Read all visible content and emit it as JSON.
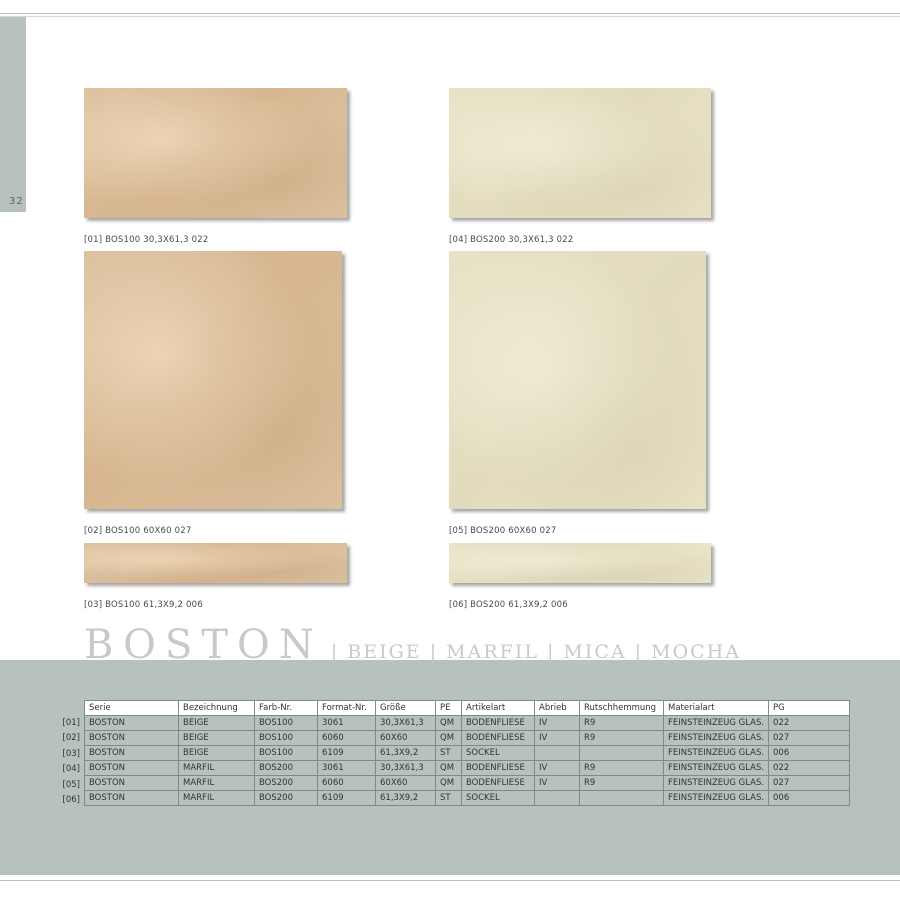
{
  "page_number": "32",
  "tiles": [
    {
      "label": "[01]  BOS100  30,3X61,3  022"
    },
    {
      "label": "[02]  BOS100  60X60  027"
    },
    {
      "label": "[03]  BOS100  61,3X9,2  006"
    },
    {
      "label": "[04]  BOS200  30,3X61,3  022"
    },
    {
      "label": "[05]  BOS200  60X60  027"
    },
    {
      "label": "[06]  BOS200  61,3X9,2  006"
    }
  ],
  "title": {
    "main": "BOSTON",
    "sub": " | BEIGE | MARFIL | MICA | MOCHA"
  },
  "table": {
    "headers": [
      "Serie",
      "Bezeichnung",
      "Farb-Nr.",
      "Format-Nr.",
      "Größe",
      "PE",
      "Artikelart",
      "Abrieb",
      "Rutschhemmung",
      "Materialart",
      "PG"
    ],
    "row_labels": [
      "[01]",
      "[02]",
      "[03]",
      "[04]",
      "[05]",
      "[06]"
    ],
    "rows": [
      [
        "BOSTON",
        "BEIGE",
        "BOS100",
        "3061",
        "30,3X61,3",
        "QM",
        "BODENFLIESE",
        "IV",
        "R9",
        "FEINSTEINZEUG GLAS.",
        "022"
      ],
      [
        "BOSTON",
        "BEIGE",
        "BOS100",
        "6060",
        "60X60",
        "QM",
        "BODENFLIESE",
        "IV",
        "R9",
        "FEINSTEINZEUG GLAS.",
        "027"
      ],
      [
        "BOSTON",
        "BEIGE",
        "BOS100",
        "6109",
        "61,3X9,2",
        "ST",
        "SOCKEL",
        "",
        "",
        "FEINSTEINZEUG GLAS.",
        "006"
      ],
      [
        "BOSTON",
        "MARFIL",
        "BOS200",
        "3061",
        "30,3X61,3",
        "QM",
        "BODENFLIESE",
        "IV",
        "R9",
        "FEINSTEINZEUG GLAS.",
        "022"
      ],
      [
        "BOSTON",
        "MARFIL",
        "BOS200",
        "6060",
        "60X60",
        "QM",
        "BODENFLIESE",
        "IV",
        "R9",
        "FEINSTEINZEUG GLAS.",
        "027"
      ],
      [
        "BOSTON",
        "MARFIL",
        "BOS200",
        "6109",
        "61,3X9,2",
        "ST",
        "SOCKEL",
        "",
        "",
        "FEINSTEINZEUG GLAS.",
        "006"
      ]
    ]
  },
  "colors": {
    "band": "#b8c2bd",
    "beige": "#d8b893",
    "marfil": "#e5dfc2"
  }
}
